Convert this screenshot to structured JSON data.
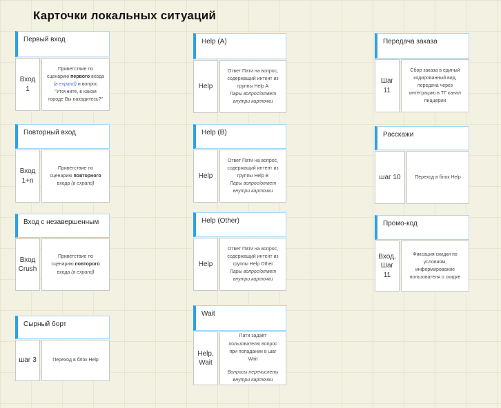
{
  "board_title": "Карточки локальных ситуаций",
  "colors": {
    "accent_blue": "#2da0e8",
    "header_border_blue": "#a9d6f3",
    "link_blue": "#4a6de0",
    "canvas_background": "#f2f1e2"
  },
  "cards": [
    {
      "title": "Первый вход",
      "label": "Вход 1",
      "text": {
        "t1": "Приветствие по сценарию ",
        "bold": "первого",
        "t2": " входа ",
        "link": "(в expand)",
        "t3": "  и вопрос",
        "quote": "\"Уточните, в каком городе Вы находитесь?\""
      }
    },
    {
      "title": "Повторный вход",
      "label": "Вход 1+n",
      "text": {
        "t1": "Приветствие по сценарию ",
        "bold": "повторного",
        "t2": " входа ",
        "em": "(в expand)"
      }
    },
    {
      "title": "Вход с незавершенным",
      "label": "Вход Crush",
      "text": {
        "t1": "Приветствие по сценарию ",
        "bold": "повторого",
        "t2": " входа ",
        "em": "(в expand)"
      }
    },
    {
      "title": "Сырный борт",
      "label": "шаг 3",
      "text": {
        "main": "Переход в блок Help"
      }
    },
    {
      "title": "Help (A)",
      "label": "Help",
      "text": {
        "main": "Ответ Пати на вопрос, содержащий интент из группы Help A",
        "em": "Пары вопрос/ответ внутри карточки"
      }
    },
    {
      "title": "Help (B)",
      "label": "Help",
      "text": {
        "main": "Ответ Пати на вопрос, содержащий интент из группы Help B",
        "em": "Пары вопрос/ответ внутри карточки"
      }
    },
    {
      "title": "Help (Other)",
      "label": "Help",
      "text": {
        "main": "Ответ Пати на вопрос, содержащий интент из группы Help Other",
        "em": "Пары вопрос/ответ внутри карточки"
      }
    },
    {
      "title": "Wait",
      "label": "Help, Wait",
      "text": {
        "main": "Пати задаёт пользователю вопрос при попадании в шаг Wait",
        "em": "Вопросы перечислены внутри карточки"
      }
    },
    {
      "title": "Передача заказа",
      "label": "Шаг 11",
      "text": {
        "main": "Сбор заказа в единый кодированный вид, передача через интеграцию в ТГ канал пиццерии"
      }
    },
    {
      "title": "Расскажи",
      "label": "шаг 10",
      "text": {
        "main": "Переход в блок Help"
      }
    },
    {
      "title": "Промо-код",
      "label": "Вход, Шаг 11",
      "text": {
        "main": "Фиксация скидки по условиям, информирование пользователя о скидке"
      }
    }
  ]
}
